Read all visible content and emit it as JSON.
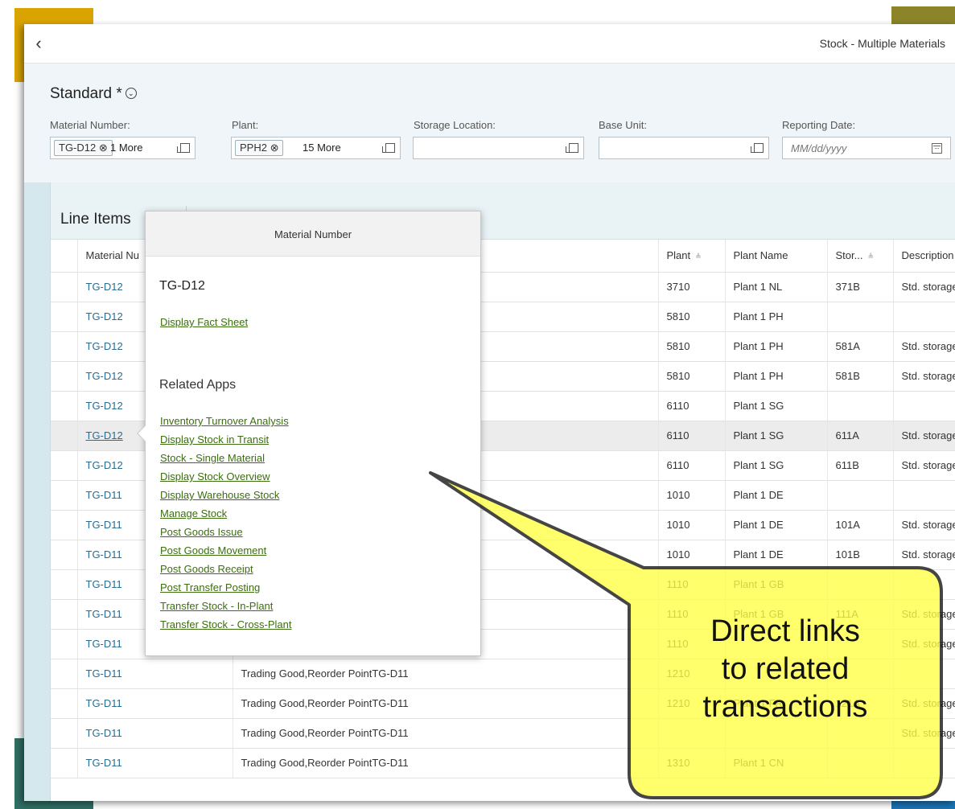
{
  "app": {
    "title": "Stock - Multiple Materials",
    "back_icon": "chevron-left-icon"
  },
  "filterbar": {
    "variant": "Standard *",
    "variant_icon": "chevron-down-circle-icon",
    "fields": {
      "material": {
        "label": "Material Number:",
        "token": "TG-D12 ⊗",
        "more": "1 More"
      },
      "plant": {
        "label": "Plant:",
        "token": "PPH2 ⊗",
        "more": "15 More"
      },
      "storage": {
        "label": "Storage Location:",
        "value": ""
      },
      "base_unit": {
        "label": "Base Unit:",
        "value": ""
      },
      "reporting_date": {
        "label": "Reporting Date:",
        "placeholder": "MM/dd/yyyy"
      }
    }
  },
  "table": {
    "tab_label": "Line Items",
    "columns": {
      "material": "Material Nu",
      "plant": "Plant",
      "plant_name": "Plant Name",
      "storage": "Stor...",
      "description": "Description",
      "sort_glyph": "≜"
    },
    "rows": [
      {
        "material": "TG-D12",
        "text": "",
        "plant": "3710",
        "plant_name": "Plant 1 NL",
        "storage": "371B",
        "description": "Std. storage"
      },
      {
        "material": "TG-D12",
        "text": "",
        "plant": "5810",
        "plant_name": "Plant 1 PH",
        "storage": "",
        "description": ""
      },
      {
        "material": "TG-D12",
        "text": "",
        "plant": "5810",
        "plant_name": "Plant 1 PH",
        "storage": "581A",
        "description": "Std. storage"
      },
      {
        "material": "TG-D12",
        "text": "",
        "plant": "5810",
        "plant_name": "Plant 1 PH",
        "storage": "581B",
        "description": "Std. storage"
      },
      {
        "material": "TG-D12",
        "text": "",
        "plant": "6110",
        "plant_name": "Plant 1 SG",
        "storage": "",
        "description": ""
      },
      {
        "material": "TG-D12",
        "text": "",
        "plant": "6110",
        "plant_name": "Plant 1 SG",
        "storage": "611A",
        "description": "Std. storage"
      },
      {
        "material": "TG-D12",
        "text": "",
        "plant": "6110",
        "plant_name": "Plant 1 SG",
        "storage": "611B",
        "description": "Std. storage"
      },
      {
        "material": "TG-D11",
        "text": "",
        "plant": "1010",
        "plant_name": "Plant 1 DE",
        "storage": "",
        "description": ""
      },
      {
        "material": "TG-D11",
        "text": "",
        "plant": "1010",
        "plant_name": "Plant 1 DE",
        "storage": "101A",
        "description": "Std. storage"
      },
      {
        "material": "TG-D11",
        "text": "",
        "plant": "1010",
        "plant_name": "Plant 1 DE",
        "storage": "101B",
        "description": "Std. storage"
      },
      {
        "material": "TG-D11",
        "text": "",
        "plant": "1110",
        "plant_name": "Plant 1 GB",
        "storage": "",
        "description": ""
      },
      {
        "material": "TG-D11",
        "text": "",
        "plant": "1110",
        "plant_name": "Plant 1 GB",
        "storage": "111A",
        "description": "Std. storage"
      },
      {
        "material": "TG-D11",
        "text": "",
        "plant": "1110",
        "plant_name": "",
        "storage": "",
        "description": "Std. storage"
      },
      {
        "material": "TG-D11",
        "text": "Trading Good,Reorder PointTG-D11",
        "plant": "1210",
        "plant_name": "",
        "storage": "",
        "description": ""
      },
      {
        "material": "TG-D11",
        "text": "Trading Good,Reorder PointTG-D11",
        "plant": "1210",
        "plant_name": "Plant 1 FR",
        "storage": "121A",
        "description": "Std. storage"
      },
      {
        "material": "TG-D11",
        "text": "Trading Good,Reorder PointTG-D11",
        "plant": "",
        "plant_name": "",
        "storage": "",
        "description": "Std. storage"
      },
      {
        "material": "TG-D11",
        "text": "Trading Good,Reorder PointTG-D11",
        "plant": "1310",
        "plant_name": "Plant 1 CN",
        "storage": "",
        "description": ""
      }
    ]
  },
  "popover": {
    "title": "Material Number",
    "material": "TG-D12",
    "fact_sheet_link": "Display Fact Sheet",
    "related_heading": "Related Apps",
    "links": [
      "Inventory Turnover Analysis",
      "Display Stock in Transit",
      "Stock - Single Material",
      "Display Stock Overview",
      "Display Warehouse Stock",
      "Manage Stock",
      "Post Goods Issue",
      "Post Goods Movement",
      "Post Goods Receipt",
      "Post Transfer Posting",
      "Transfer Stock - In-Plant",
      "Transfer Stock - Cross-Plant"
    ]
  },
  "callout": {
    "lines": [
      "Direct links",
      "to related",
      "transactions"
    ],
    "fill": "#ffff44",
    "stroke": "#111111"
  }
}
